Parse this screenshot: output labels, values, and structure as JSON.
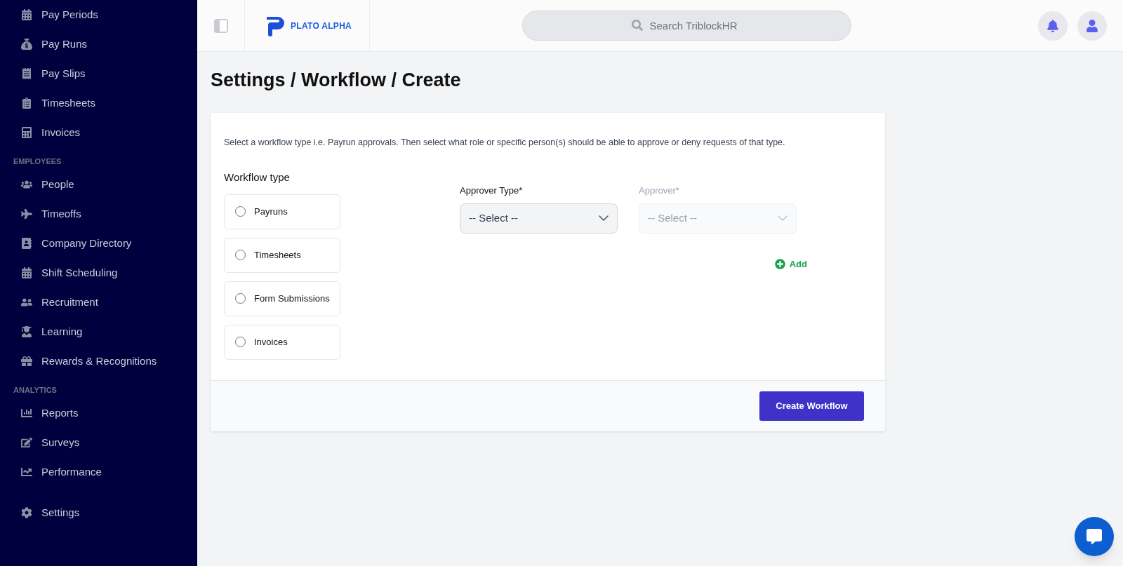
{
  "sidebar": {
    "sections": [
      {
        "items": [
          {
            "label": "Pay Periods"
          },
          {
            "label": "Pay Runs"
          },
          {
            "label": "Pay Slips"
          },
          {
            "label": "Timesheets"
          },
          {
            "label": "Invoices"
          }
        ]
      },
      {
        "heading": "EMPLOYEES",
        "items": [
          {
            "label": "People"
          },
          {
            "label": "Timeoffs"
          },
          {
            "label": "Company Directory"
          },
          {
            "label": "Shift Scheduling"
          },
          {
            "label": "Recruitment"
          },
          {
            "label": "Learning"
          },
          {
            "label": "Rewards & Recognitions"
          }
        ]
      },
      {
        "heading": "ANALYTICS",
        "items": [
          {
            "label": "Reports"
          },
          {
            "label": "Surveys"
          },
          {
            "label": "Performance"
          }
        ]
      },
      {
        "items": [
          {
            "label": "Settings"
          }
        ]
      }
    ]
  },
  "header": {
    "logo": "PLATO ALPHA",
    "search": {
      "placeholder": "Search TriblockHR"
    }
  },
  "page_title": "Settings / Workflow / Create",
  "form": {
    "description": "Select a workflow type i.e. Payrun approvals. Then select what role or specific person(s) should be able to approve or deny requests of that type.",
    "workflow_type_label": "Workflow type",
    "workflow_types": [
      {
        "label": "Payruns",
        "selected": false
      },
      {
        "label": "Timesheets",
        "selected": false
      },
      {
        "label": "Form Submissions",
        "selected": false
      },
      {
        "label": "Invoices",
        "selected": false
      }
    ],
    "selects": [
      {
        "label": "Approver Type*",
        "value": "-- Select --",
        "disabled": false
      },
      {
        "label": "Approver*",
        "value": "-- Select --",
        "disabled": true
      }
    ],
    "add_button": "Add",
    "submit_button": "Create Workflow"
  }
}
